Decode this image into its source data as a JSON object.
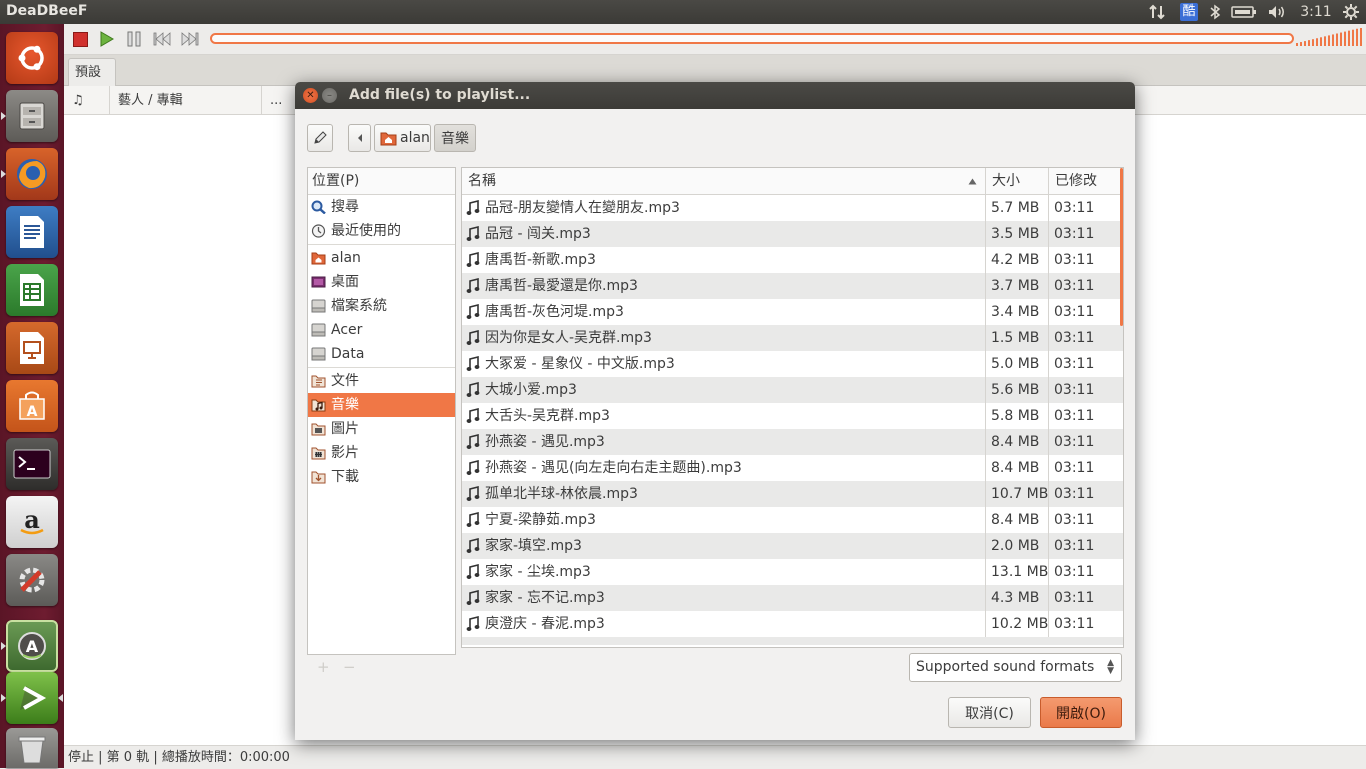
{
  "top_panel": {
    "app_title": "DeaDBeeF",
    "input_method": "酷",
    "clock": "3:11"
  },
  "launcher": {
    "items": [
      "dash-home",
      "files",
      "firefox",
      "libreoffice-writer",
      "libreoffice-calc",
      "libreoffice-impress",
      "ubuntu-software-center",
      "terminal",
      "amazon",
      "system-settings",
      "software-updater",
      "deadbeef",
      "trash"
    ]
  },
  "player": {
    "tab_label": "預設",
    "columns": {
      "playing": "♫",
      "artist_album": "藝人 / 專輯",
      "more": "..."
    },
    "status": "停止 | 第 0 軌 | 總播放時間：0:00:00"
  },
  "dialog": {
    "title": "Add file(s) to playlist...",
    "path": [
      "alan",
      "音樂"
    ],
    "places_header": "位置(P)",
    "places": [
      {
        "label": "搜尋",
        "icon": "search-icon"
      },
      {
        "label": "最近使用的",
        "icon": "clock-icon"
      },
      {
        "label": "alan",
        "icon": "home-folder-icon"
      },
      {
        "label": "桌面",
        "icon": "desktop-icon"
      },
      {
        "label": "檔案系統",
        "icon": "drive-icon"
      },
      {
        "label": "Acer",
        "icon": "drive-icon"
      },
      {
        "label": "Data",
        "icon": "drive-icon"
      },
      {
        "label": "文件",
        "icon": "documents-folder-icon"
      },
      {
        "label": "音樂",
        "icon": "music-folder-icon",
        "selected": true
      },
      {
        "label": "圖片",
        "icon": "pictures-folder-icon"
      },
      {
        "label": "影片",
        "icon": "videos-folder-icon"
      },
      {
        "label": "下載",
        "icon": "downloads-folder-icon"
      }
    ],
    "columns": {
      "name": "名稱",
      "size": "大小",
      "modified": "已修改"
    },
    "files": [
      {
        "name": "品冠-朋友變情人在變朋友.mp3",
        "size": "5.7 MB",
        "modified": "03:11"
      },
      {
        "name": "品冠 - 闯关.mp3",
        "size": "3.5 MB",
        "modified": "03:11"
      },
      {
        "name": "唐禹哲-新歌.mp3",
        "size": "4.2 MB",
        "modified": "03:11"
      },
      {
        "name": "唐禹哲-最愛還是你.mp3",
        "size": "3.7 MB",
        "modified": "03:11"
      },
      {
        "name": "唐禹哲-灰色河堤.mp3",
        "size": "3.4 MB",
        "modified": "03:11"
      },
      {
        "name": "因为你是女人-吴克群.mp3",
        "size": "1.5 MB",
        "modified": "03:11"
      },
      {
        "name": "大冢爱 - 星象仪 - 中文版.mp3",
        "size": "5.0 MB",
        "modified": "03:11"
      },
      {
        "name": "大城小爱.mp3",
        "size": "5.6 MB",
        "modified": "03:11"
      },
      {
        "name": "大舌头-吴克群.mp3",
        "size": "5.8 MB",
        "modified": "03:11"
      },
      {
        "name": "孙燕姿 - 遇见.mp3",
        "size": "8.4 MB",
        "modified": "03:11"
      },
      {
        "name": "孙燕姿 - 遇见(向左走向右走主题曲).mp3",
        "size": "8.4 MB",
        "modified": "03:11"
      },
      {
        "name": "孤单北半球-林依晨.mp3",
        "size": "10.7 MB",
        "modified": "03:11"
      },
      {
        "name": "宁夏-梁静茹.mp3",
        "size": "8.4 MB",
        "modified": "03:11"
      },
      {
        "name": "家家-填空.mp3",
        "size": "2.0 MB",
        "modified": "03:11"
      },
      {
        "name": "家家 - 尘埃.mp3",
        "size": "13.1 MB",
        "modified": "03:11"
      },
      {
        "name": "家家 - 忘不记.mp3",
        "size": "4.3 MB",
        "modified": "03:11"
      },
      {
        "name": "庾澄庆 - 春泥.mp3",
        "size": "10.2 MB",
        "modified": "03:11"
      }
    ],
    "filter": "Supported sound formats",
    "cancel_label": "取消(C)",
    "open_label": "開啟(O)",
    "add_place": "+",
    "remove_place": "−",
    "colors": {
      "accent": "#f07746",
      "titlebar": "#3c3b37"
    }
  }
}
